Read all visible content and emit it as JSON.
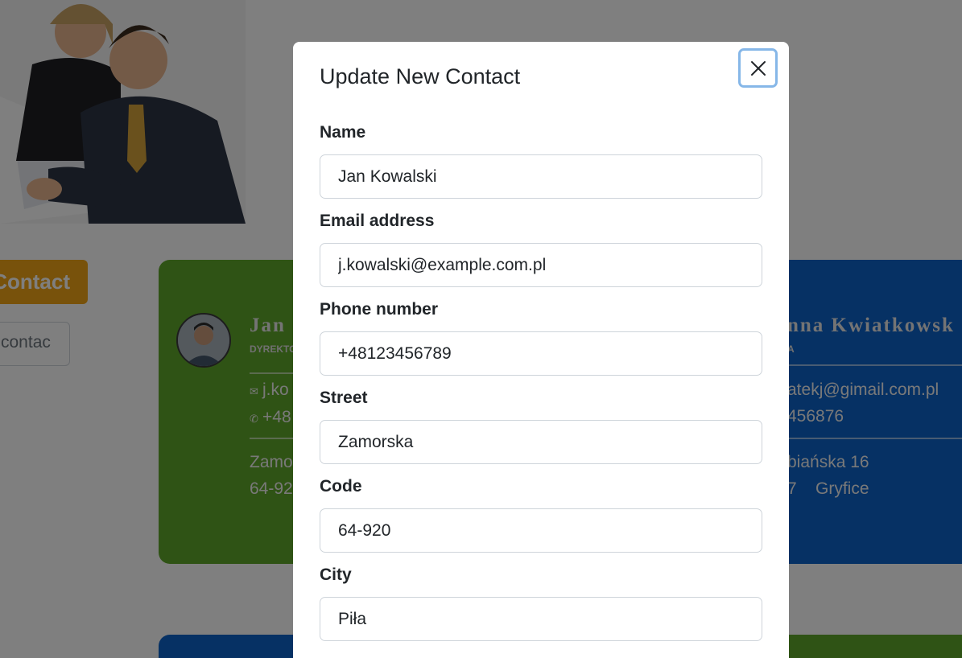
{
  "background": {
    "add_button_label": "Contact",
    "search_value": "contac",
    "cards": [
      {
        "name": "Jan",
        "role": "DYREKTO",
        "email": "j.ko",
        "phone": "+48",
        "street": "Zamo",
        "code_city": "64-92",
        "color": "#5fa62b"
      },
      {
        "name": "nna Kwiatkowsk",
        "role": "A",
        "email": "atekj@gimail.com.pl",
        "phone": "456876",
        "street": "biańska 16",
        "code_city": "7    Gryfice",
        "color": "#0d62c8"
      }
    ]
  },
  "modal": {
    "title": "Update New Contact",
    "close_icon": "close-icon",
    "fields": [
      {
        "label": "Name",
        "value": "Jan Kowalski"
      },
      {
        "label": "Email address",
        "value": "j.kowalski@example.com.pl"
      },
      {
        "label": "Phone number",
        "value": "+48123456789"
      },
      {
        "label": "Street",
        "value": "Zamorska"
      },
      {
        "label": "Code",
        "value": "64-920"
      },
      {
        "label": "City",
        "value": "Piła"
      }
    ]
  },
  "colors": {
    "accent_orange": "#f0a416",
    "card_green": "#5fa62b",
    "card_blue": "#0d62c8",
    "focus_ring": "#86b7e8"
  }
}
